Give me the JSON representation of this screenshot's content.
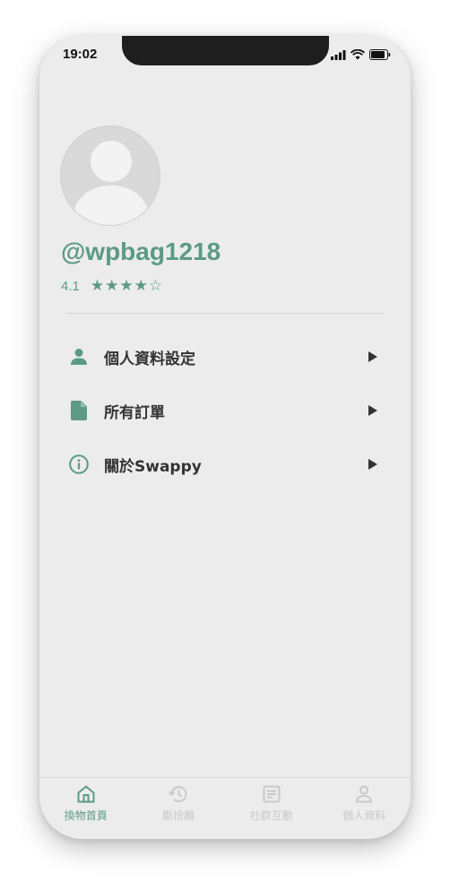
{
  "status_bar": {
    "time": "19:02"
  },
  "profile": {
    "username": "@wpbag1218",
    "rating_value": "4.1",
    "stars_filled": 4,
    "stars_total": 5
  },
  "menu": {
    "items": [
      {
        "label": "個人資料設定",
        "icon": "person-icon"
      },
      {
        "label": "所有訂單",
        "icon": "document-icon"
      },
      {
        "label": "關於Swappy",
        "icon": "info-icon"
      }
    ]
  },
  "tabbar": {
    "tabs": [
      {
        "label": "換物首頁",
        "icon": "home-icon",
        "active": true
      },
      {
        "label": "斷捨離",
        "icon": "history-icon",
        "active": false
      },
      {
        "label": "社群互動",
        "icon": "article-icon",
        "active": false
      },
      {
        "label": "個人資料",
        "icon": "person-outline-icon",
        "active": false
      }
    ]
  },
  "colors": {
    "accent": "#5c9a86",
    "background": "#ececec",
    "inactive": "#c9c9c9",
    "text": "#333333"
  }
}
